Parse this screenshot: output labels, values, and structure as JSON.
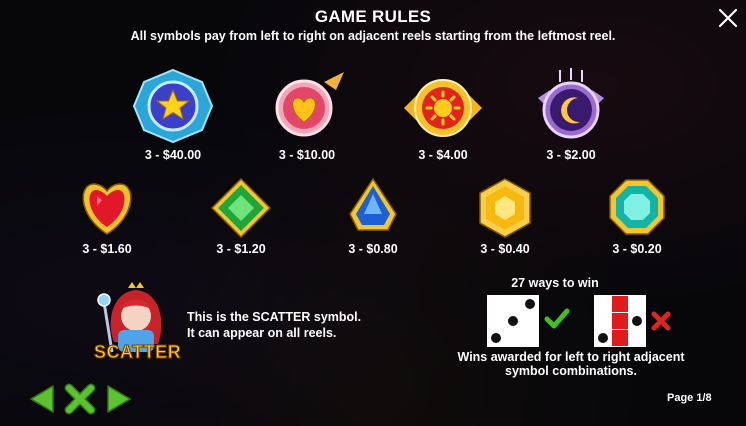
{
  "header": {
    "title": "GAME RULES",
    "subtitle": "All symbols pay from left to right on adjacent reels starting from the leftmost reel."
  },
  "symbols": [
    {
      "icon": "star-gem-icon",
      "payout": "3 - $40.00"
    },
    {
      "icon": "heart-badge-icon",
      "payout": "3 - $10.00"
    },
    {
      "icon": "sun-badge-icon",
      "payout": "3 - $4.00"
    },
    {
      "icon": "moon-badge-icon",
      "payout": "3 - $2.00"
    },
    {
      "icon": "red-heart-gem-icon",
      "payout": "3 - $1.60"
    },
    {
      "icon": "green-diamond-gem-icon",
      "payout": "3 - $1.20"
    },
    {
      "icon": "blue-drop-gem-icon",
      "payout": "3 - $0.80"
    },
    {
      "icon": "yellow-hexagon-gem-icon",
      "payout": "3 - $0.40"
    },
    {
      "icon": "teal-octagon-gem-icon",
      "payout": "3 - $0.20"
    }
  ],
  "scatter": {
    "label": "SCATTER",
    "line1": "This is the SCATTER symbol.",
    "line2": "It can appear on all reels."
  },
  "ways": {
    "title": "27 ways to win",
    "note_line1": "Wins awarded for left to right adjacent",
    "note_line2": "symbol combinations."
  },
  "footer": {
    "page": "Page 1/8"
  },
  "colors": {
    "nav_green": "#5dc22e",
    "check_green": "#3fc21c",
    "x_red": "#e02424"
  }
}
